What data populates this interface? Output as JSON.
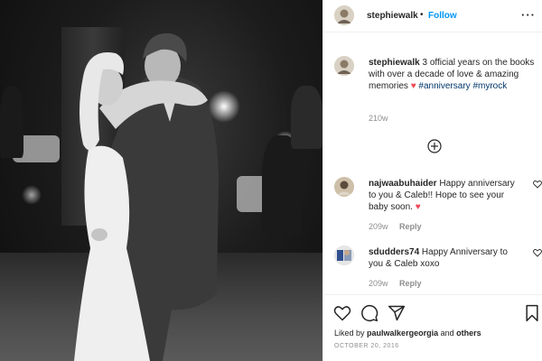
{
  "post": {
    "username": "stephiewalk",
    "follow_label": "Follow",
    "separator": "•",
    "more_label": "···"
  },
  "caption": {
    "username": "stephiewalk",
    "text": "3 official years on the books with over a decade of love & amazing memories",
    "heart": "♥",
    "hashtags": [
      "#anniversary",
      "#myrock"
    ],
    "time": "210w"
  },
  "comments": [
    {
      "username": "najwaabuhaider",
      "text": "Happy anniversary to you & Caleb!! Hope to see your baby soon.",
      "heart": "♥",
      "time": "209w",
      "reply_label": "Reply"
    },
    {
      "username": "sdudders74",
      "text": "Happy Anniversary to you & Caleb xoxo",
      "time": "209w",
      "reply_label": "Reply"
    }
  ],
  "likes": {
    "prefix": "Liked by",
    "user": "paulwalkergeorgia",
    "conjunction": "and",
    "others": "others"
  },
  "date": "OCTOBER 20, 2016",
  "icons": [
    "heart-outline-icon",
    "comment-icon",
    "share-icon",
    "bookmark-icon",
    "add-comments-icon",
    "ellipsis-icon"
  ],
  "colors": {
    "follow": "#0095f6",
    "hashtag": "#00376b",
    "heart": "#ed4956",
    "muted": "#8e8e8e"
  }
}
